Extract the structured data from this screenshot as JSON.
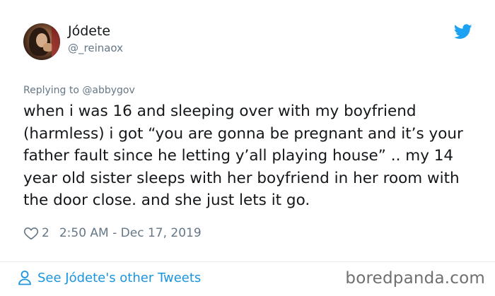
{
  "author": {
    "display_name": "Jódete",
    "handle": "@_reinaox"
  },
  "reply": {
    "prefix": "Replying to ",
    "mention": "@abbygov"
  },
  "tweet": {
    "text": "when i was 16 and sleeping over with my boyfriend (harmless) i got “you are gonna be pregnant and it’s your father fault since he letting y’all playing house” .. my 14 year old sister sleeps with her boyfriend in her room with the door close. and she just lets it go."
  },
  "meta": {
    "like_count": "2",
    "timestamp": "2:50 AM - Dec 17, 2019"
  },
  "footer": {
    "see_more_label": "See Jódete's other Tweets"
  },
  "watermark": "boredpanda.com",
  "icons": {
    "brand": "twitter-bird-icon",
    "like": "heart-icon",
    "profile": "person-icon"
  },
  "colors": {
    "twitter_blue": "#1da1f2",
    "link_blue": "#1b95e0",
    "secondary_text": "#657786",
    "primary_text": "#14171a"
  }
}
